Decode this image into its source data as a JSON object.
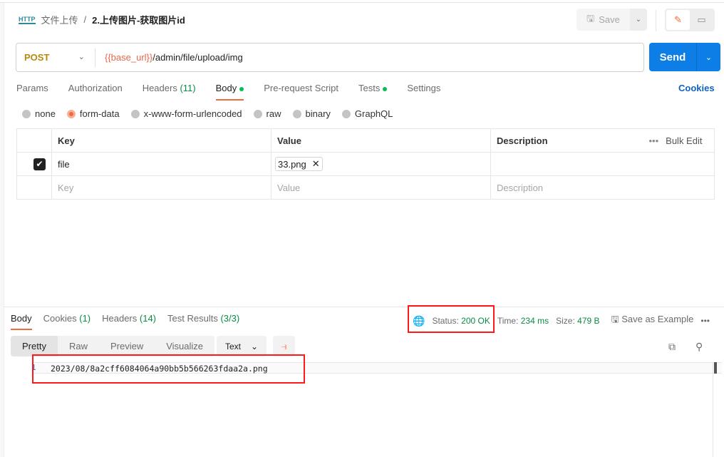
{
  "breadcrumb": {
    "collection": "文件上传",
    "separator": "/",
    "request": "2.上传图片-获取图片id",
    "icon": "HTTP"
  },
  "toolbar": {
    "save": "Save"
  },
  "request": {
    "method": "POST",
    "url_var": "{{base_url}}",
    "url_path": "/admin/file/upload/img",
    "send": "Send"
  },
  "tabs": [
    {
      "label": "Params"
    },
    {
      "label": "Authorization"
    },
    {
      "label": "Headers",
      "count": "(11)"
    },
    {
      "label": "Body",
      "dot": true
    },
    {
      "label": "Pre-request Script"
    },
    {
      "label": "Tests",
      "dot": true
    },
    {
      "label": "Settings"
    }
  ],
  "cookies": "Cookies",
  "body_modes": [
    "none",
    "form-data",
    "x-www-form-urlencoded",
    "raw",
    "binary",
    "GraphQL"
  ],
  "selected_mode": "form-data",
  "table": {
    "headers": [
      "Key",
      "Value",
      "Description"
    ],
    "bulk_edit": "Bulk Edit",
    "rows": [
      {
        "checked": true,
        "key": "file",
        "value": "33.png"
      }
    ],
    "placeholders": {
      "key": "Key",
      "value": "Value",
      "description": "Description"
    }
  },
  "response": {
    "tabs": [
      {
        "label": "Body"
      },
      {
        "label": "Cookies",
        "count": "(1)"
      },
      {
        "label": "Headers",
        "count": "(14)"
      },
      {
        "label": "Test Results",
        "count": "(3/3)"
      }
    ],
    "status_label": "Status:",
    "status": "200 OK",
    "time_label": "Time:",
    "time": "234 ms",
    "size_label": "Size:",
    "size": "479 B",
    "save_example": "Save as Example",
    "views": [
      "Pretty",
      "Raw",
      "Preview",
      "Visualize"
    ],
    "format": "Text",
    "line_number": "1",
    "body": "2023/08/8a2cff6084064a90bb5b566263fdaa2a.png"
  },
  "colors": {
    "accent": "#f26b3a",
    "send": "#0c7ee6",
    "success": "#0a8a43",
    "highlight": "#ff1a1a"
  }
}
